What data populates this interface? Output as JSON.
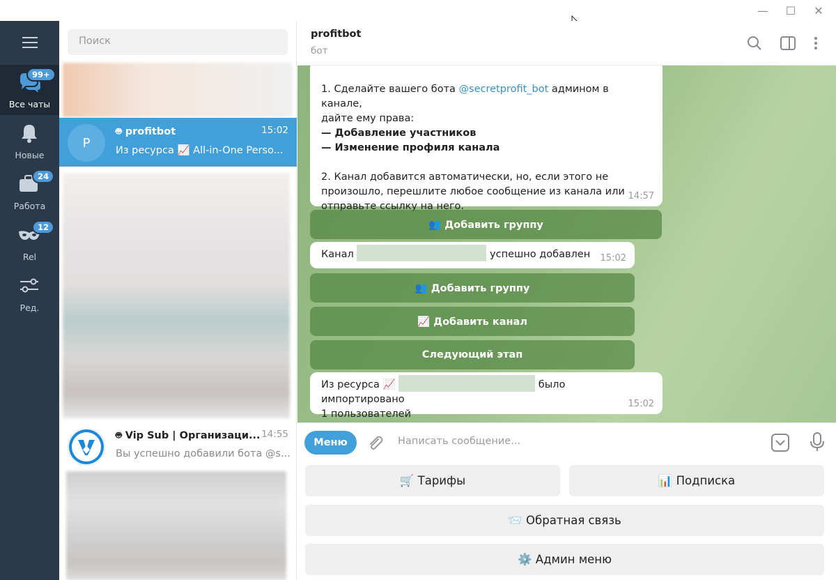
{
  "window": {
    "controls": {
      "minimize": "—",
      "maximize": "☐",
      "close": "✕"
    }
  },
  "rail": {
    "items": [
      {
        "label": "Все чаты",
        "badge": "99+",
        "icon": "chats-icon"
      },
      {
        "label": "Новые",
        "badge": "",
        "icon": "bell-icon"
      },
      {
        "label": "Работа",
        "badge": "24",
        "icon": "briefcase-icon"
      },
      {
        "label": "Rel",
        "badge": "12",
        "icon": "mask-icon"
      },
      {
        "label": "Ред.",
        "badge": "",
        "icon": "sliders-icon"
      }
    ]
  },
  "chatlist": {
    "search_placeholder": "Поиск",
    "chats": [
      {
        "avatar_letter": "P",
        "name": "profitbot",
        "time": "15:02",
        "preview": "Из ресурса 📈 All-in-One Perso..."
      },
      {
        "avatar_letter": "",
        "name": "Vip Sub | Организаци...",
        "time": "14:55",
        "preview": "Вы успешно добавили бота @s..."
      }
    ]
  },
  "header": {
    "title": "profitbot",
    "subtitle": "бот"
  },
  "messages": {
    "m1": {
      "step1_prefix": "1. Сделайте вашего бота ",
      "step1_link": "@secretprofit_bot",
      "step1_suffix": " админом в канале,",
      "step1_line2": "дайте ему права:",
      "right1": "— Добавление участников",
      "right2": "— Изменение профиля канала",
      "step2_line1": "2. Канал добавится автоматически, но, если этого не",
      "step2_line2": "произошло, перешлите любое сообщение из канала или",
      "step2_line3": "отправьте ссылку на него.",
      "time": "14:57"
    },
    "btn_add_group_1": "👥 Добавить группу",
    "m2": {
      "prefix": "Канал ",
      "suffix": " успешно добавлен",
      "time": "15:02"
    },
    "btn_add_group_2": "👥 Добавить группу",
    "btn_add_channel": "📈 Добавить канал",
    "btn_next_step": "Следующий этап",
    "m3": {
      "prefix": "Из ресурса 📈 ",
      "suffix": " было импортировано",
      "line2": "1 пользователей",
      "time": "15:02"
    }
  },
  "composer": {
    "menu_label": "Меню",
    "placeholder": "Написать сообщение..."
  },
  "keyboard": {
    "tariffs": "🛒 Тарифы",
    "subscription": "📊 Подписка",
    "feedback": "📨 Обратная связь",
    "admin_menu": "⚙️ Админ меню"
  },
  "colors": {
    "accent": "#419fd9",
    "rail_bg": "#2b3a4a",
    "button_green": "#548742"
  }
}
